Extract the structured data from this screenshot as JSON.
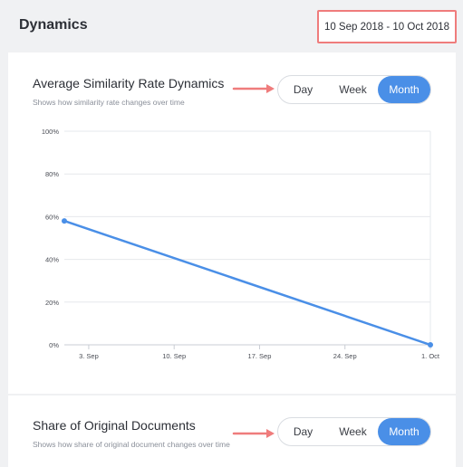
{
  "header": {
    "title": "Dynamics",
    "date_range": "10 Sep 2018 - 10 Oct 2018"
  },
  "cards": {
    "similarity": {
      "title": "Average Similarity Rate Dynamics",
      "subtitle": "Shows how similarity rate changes over time",
      "toggle": {
        "day": "Day",
        "week": "Week",
        "month": "Month",
        "selected": "Month"
      }
    },
    "original": {
      "title": "Share of Original Documents",
      "subtitle": "Shows how share of original document changes over time",
      "toggle": {
        "day": "Day",
        "week": "Week",
        "month": "Month",
        "selected": "Month"
      }
    }
  },
  "colors": {
    "accent": "#4a8fe7",
    "annotation": "#ef7c7c"
  },
  "chart_data": {
    "type": "line",
    "x_ticks": [
      "3. Sep",
      "10. Sep",
      "17. Sep",
      "24. Sep",
      "1. Oct"
    ],
    "y_ticks": [
      "0%",
      "20%",
      "40%",
      "60%",
      "80%",
      "100%"
    ],
    "series": [
      {
        "x": [
          "1. Sep",
          "1. Oct"
        ],
        "y": [
          58,
          0
        ]
      }
    ],
    "ylim": [
      0,
      100
    ],
    "xlim": [
      "1. Sep",
      "1. Oct"
    ],
    "grid": true,
    "color": "#4a8fe7"
  }
}
